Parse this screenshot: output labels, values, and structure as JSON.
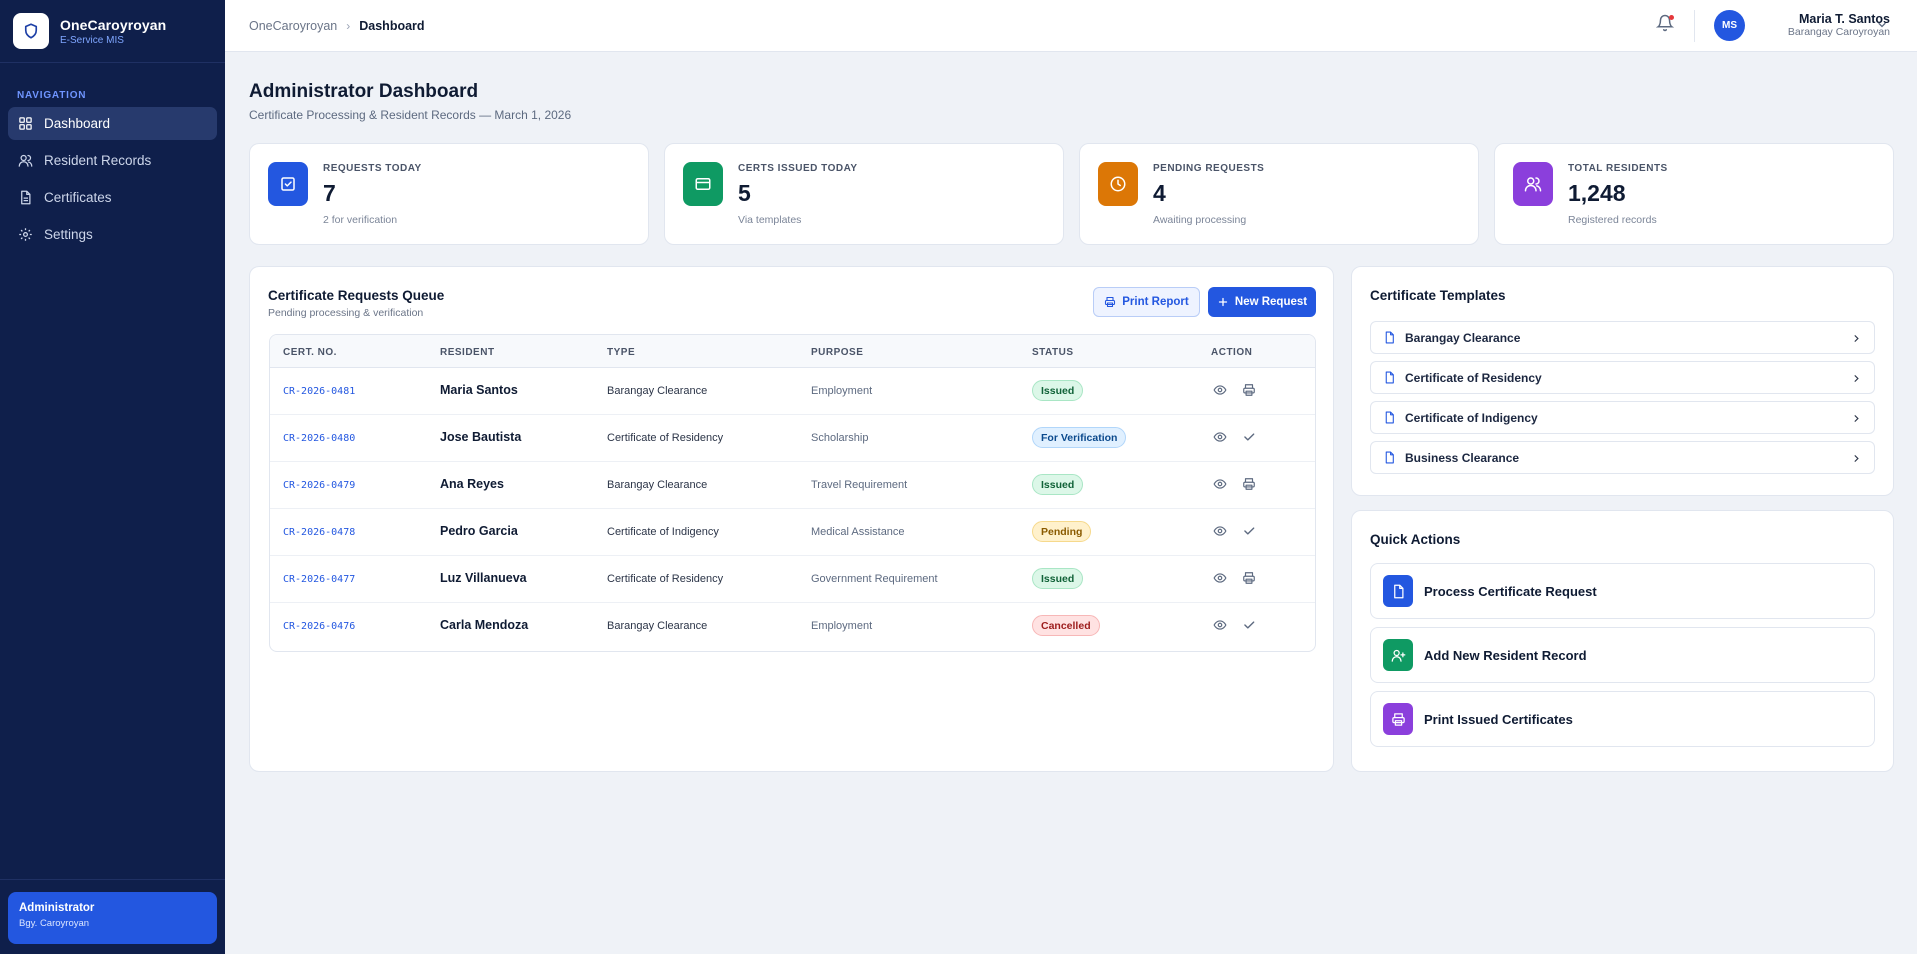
{
  "brand": {
    "name": "OneCaroyroyan",
    "subtitle": "E-Service MIS"
  },
  "nav": {
    "section_label": "NAVIGATION",
    "items": [
      {
        "label": "Dashboard",
        "icon": "grid-icon",
        "active": true
      },
      {
        "label": "Resident Records",
        "icon": "user-icon"
      },
      {
        "label": "Certificates",
        "icon": "document-icon"
      },
      {
        "label": "Settings",
        "icon": "gear-icon"
      }
    ]
  },
  "sidebar_footer": {
    "role": "Administrator",
    "location": "Bgy. Caroyroyan"
  },
  "breadcrumb": {
    "root": "OneCaroyroyan",
    "current": "Dashboard"
  },
  "user": {
    "initials": "MS",
    "name": "Maria T. Santos",
    "location": "Barangay Caroyroyan"
  },
  "page": {
    "title": "Administrator Dashboard",
    "subtitle": "Certificate Processing & Resident Records — March 1, 2026"
  },
  "stats": [
    {
      "label": "REQUESTS TODAY",
      "value": "7",
      "sub": "2 for verification",
      "color": "#2357e0",
      "icon": "checkbox-icon"
    },
    {
      "label": "CERTS ISSUED TODAY",
      "value": "5",
      "sub": "Via templates",
      "color": "#0f9a63",
      "icon": "card-icon"
    },
    {
      "label": "PENDING REQUESTS",
      "value": "4",
      "sub": "Awaiting processing",
      "color": "#dc7706",
      "icon": "clock-icon"
    },
    {
      "label": "TOTAL RESIDENTS",
      "value": "1,248",
      "sub": "Registered records",
      "color": "#8b3fdc",
      "icon": "users-icon"
    }
  ],
  "queue": {
    "title": "Certificate Requests Queue",
    "subtitle": "Pending processing & verification",
    "print_label": "Print Report",
    "new_label": "New Request",
    "columns": [
      "CERT. NO.",
      "RESIDENT",
      "TYPE",
      "PURPOSE",
      "STATUS",
      "ACTION"
    ],
    "rows": [
      {
        "cert": "CR-2026-0481",
        "resident": "Maria Santos",
        "type": "Barangay Clearance",
        "purpose": "Employment",
        "status": "Issued",
        "status_kind": "issued",
        "action2": "print"
      },
      {
        "cert": "CR-2026-0480",
        "resident": "Jose Bautista",
        "type": "Certificate of Residency",
        "purpose": "Scholarship",
        "status": "For Verification",
        "status_kind": "verify",
        "action2": "check"
      },
      {
        "cert": "CR-2026-0479",
        "resident": "Ana Reyes",
        "type": "Barangay Clearance",
        "purpose": "Travel Requirement",
        "status": "Issued",
        "status_kind": "issued",
        "action2": "print"
      },
      {
        "cert": "CR-2026-0478",
        "resident": "Pedro Garcia",
        "type": "Certificate of Indigency",
        "purpose": "Medical Assistance",
        "status": "Pending",
        "status_kind": "pending",
        "action2": "check"
      },
      {
        "cert": "CR-2026-0477",
        "resident": "Luz Villanueva",
        "type": "Certificate of Residency",
        "purpose": "Government Requirement",
        "status": "Issued",
        "status_kind": "issued",
        "action2": "print"
      },
      {
        "cert": "CR-2026-0476",
        "resident": "Carla Mendoza",
        "type": "Barangay Clearance",
        "purpose": "Employment",
        "status": "Cancelled",
        "status_kind": "cancelled",
        "action2": "check"
      }
    ]
  },
  "templates": {
    "title": "Certificate Templates",
    "items": [
      "Barangay Clearance",
      "Certificate of Residency",
      "Certificate of Indigency",
      "Business Clearance"
    ]
  },
  "quick_actions": {
    "title": "Quick Actions",
    "items": [
      {
        "label": "Process Certificate Request",
        "color": "#2357e0",
        "icon": "document-icon"
      },
      {
        "label": "Add New Resident Record",
        "color": "#0f9a63",
        "icon": "user-plus-icon"
      },
      {
        "label": "Print Issued Certificates",
        "color": "#8b3fdc",
        "icon": "printer-icon"
      }
    ]
  }
}
